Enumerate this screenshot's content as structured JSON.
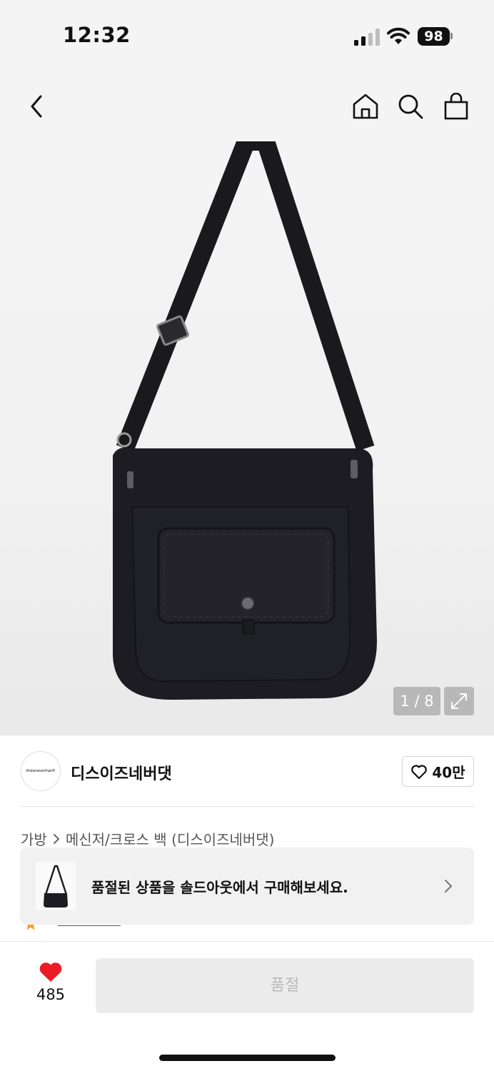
{
  "status_bar": {
    "time": "12:32",
    "battery": "98",
    "icons": [
      "signal-icon",
      "wifi-icon",
      "battery-icon"
    ]
  },
  "nav": {
    "icons": [
      "back-chevron-icon",
      "home-icon",
      "search-icon",
      "shopping-bag-icon"
    ]
  },
  "gallery": {
    "counter": "1 / 8",
    "expand_icon": "expand-icon"
  },
  "brand": {
    "logo_text": "thisisneverthat®",
    "name": "디스이즈네버댓",
    "like_count": "40만"
  },
  "breadcrumb": {
    "category": "가방",
    "subcategory": "메신저/크로스 백 (디스이즈네버댓)"
  },
  "soldout_banner": {
    "text": "품절된 상품을 솔드아웃에서 구매해보세요."
  },
  "bottom": {
    "like_count": "485",
    "buy_button": "품절"
  },
  "colors": {
    "like_red": "#ec1c24",
    "button_gray": "#ececec",
    "star_orange": "#f5a623"
  }
}
